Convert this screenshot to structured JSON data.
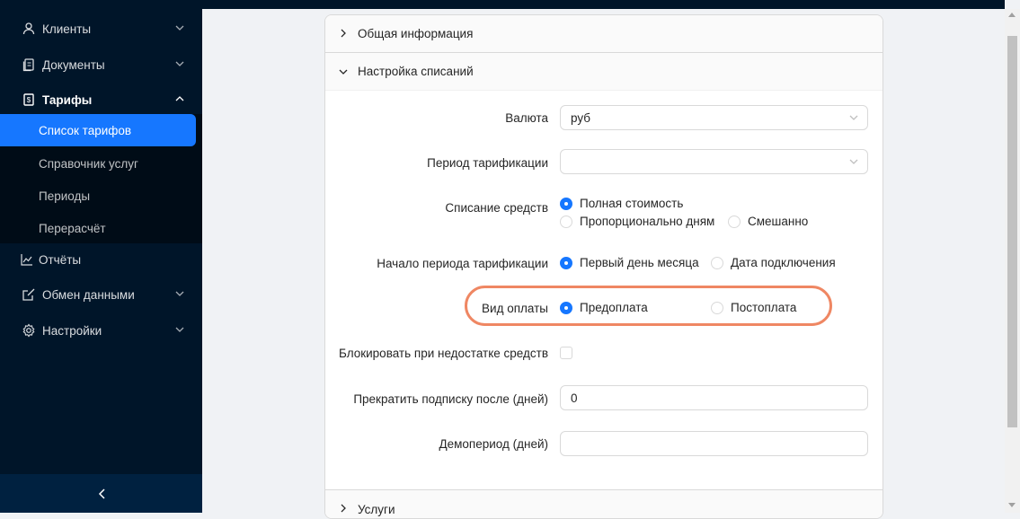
{
  "sidebar": {
    "items": [
      {
        "label": "Клиенты",
        "icon": "user-icon"
      },
      {
        "label": "Документы",
        "icon": "documents-icon"
      },
      {
        "label": "Тарифы",
        "icon": "tariff-icon"
      },
      {
        "label": "Отчёты",
        "icon": "chart-line-icon"
      },
      {
        "label": "Обмен данными",
        "icon": "edit-icon"
      },
      {
        "label": "Настройки",
        "icon": "gear-icon"
      }
    ],
    "tariff_submenu": [
      {
        "label": "Список тарифов"
      },
      {
        "label": "Справочник услуг"
      },
      {
        "label": "Периоды"
      },
      {
        "label": "Перерасчёт"
      }
    ],
    "collapse_icon": "chevron-left-icon"
  },
  "panels": {
    "general": "Общая информация",
    "billing": "Настройка списаний",
    "services": "Услуги"
  },
  "form": {
    "currency": {
      "label": "Валюта",
      "value": "руб"
    },
    "billing_period": {
      "label": "Период тарификации",
      "value": ""
    },
    "charge": {
      "label": "Списание средств",
      "options": [
        "Полная стоимость",
        "Пропорционально дням",
        "Смешанно"
      ],
      "selected": "Полная стоимость"
    },
    "period_start": {
      "label": "Начало периода тарификации",
      "options": [
        "Первый день месяца",
        "Дата подключения"
      ],
      "selected": "Первый день месяца"
    },
    "payment_type": {
      "label": "Вид оплаты",
      "options": [
        "Предоплата",
        "Постоплата"
      ],
      "selected": "Предоплата"
    },
    "block_insufficient": {
      "label": "Блокировать при недостатке средств",
      "checked": false
    },
    "stop_subscription": {
      "label": "Прекратить подписку после (дней)",
      "value": "0"
    },
    "demo_period": {
      "label": "Демопериод (дней)",
      "value": ""
    }
  },
  "colors": {
    "sidebar_bg": "#001529",
    "submenu_bg": "#000c17",
    "accent": "#1677ff",
    "highlight": "#ef8763"
  }
}
